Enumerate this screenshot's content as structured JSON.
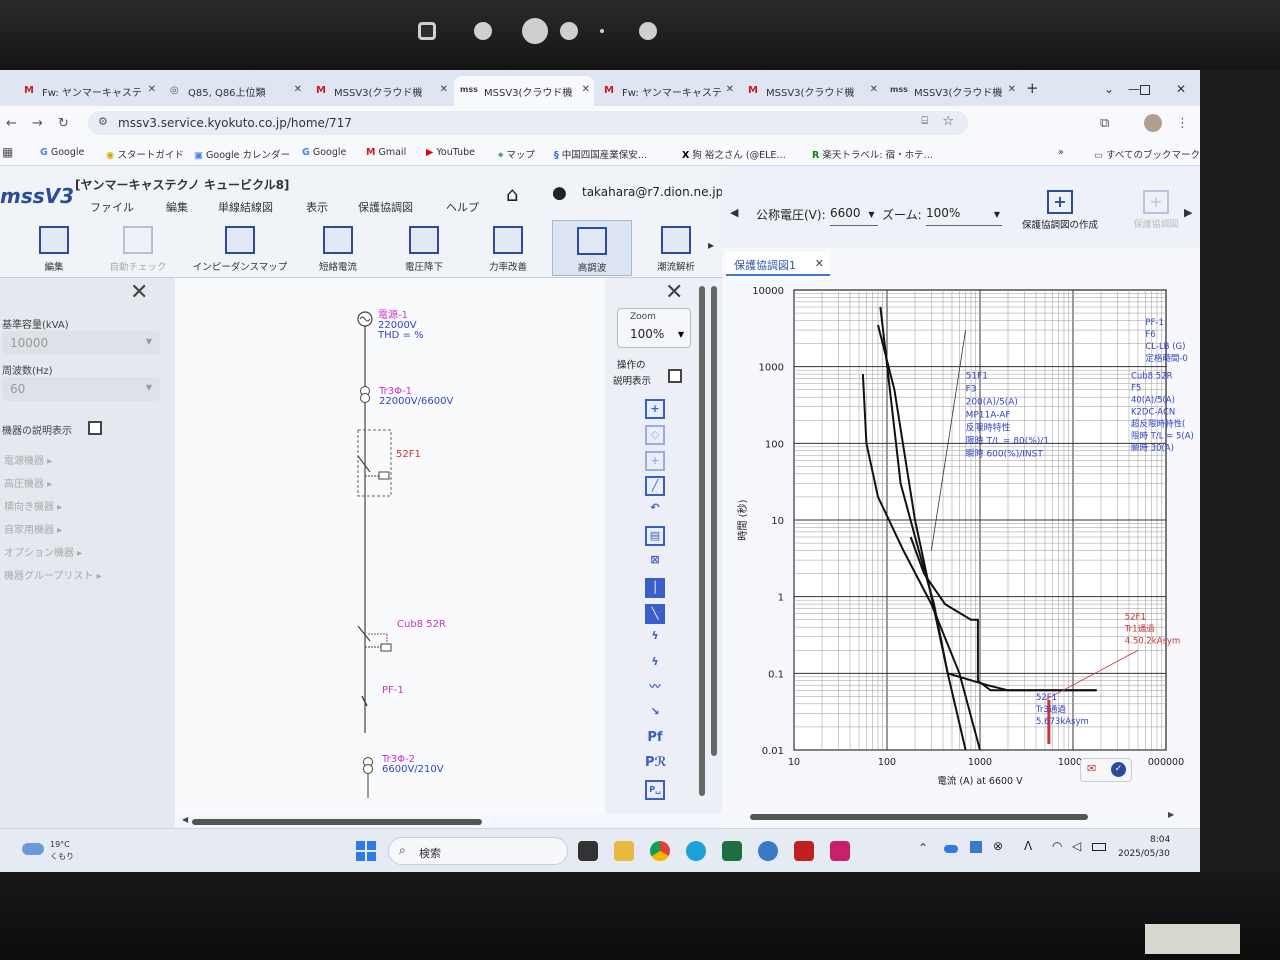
{
  "browser": {
    "tabs": [
      {
        "label": "Fw: ヤンマーキャステ",
        "fav": "M"
      },
      {
        "label": "Q85, Q86上位類",
        "fav": "◎"
      },
      {
        "label": "MSSV3(クラウド機",
        "fav": "M"
      },
      {
        "label": "MSSV3(クラウド機",
        "fav": "mss"
      },
      {
        "label": "Fw: ヤンマーキャステ",
        "fav": "M"
      },
      {
        "label": "MSSV3(クラウド機",
        "fav": "M"
      },
      {
        "label": "MSSV3(クラウド機",
        "fav": "mss"
      }
    ],
    "new_tab": "+",
    "url": "mssv3.service.kyokuto.co.jp/home/717",
    "bookmarks": [
      "Google",
      "スタートガイド",
      "Google カレンダー",
      "Google",
      "Gmail",
      "YouTube",
      "マップ",
      "中国四国産業保安…",
      "狗 裕之さん (@ELE…",
      "楽天トラベル: 宿・ホテ…",
      "すべてのブックマーク"
    ],
    "bookmarks_more": "»"
  },
  "app": {
    "logo": "mssV3",
    "project_title": "[ヤンマーキャステクノ キュービクル8]",
    "menus": [
      "ファイル",
      "編集",
      "単線結線図",
      "表示",
      "保護協調図",
      "ヘルプ"
    ],
    "user_email": "takahara@r7.dion.ne.jp",
    "ribbon": [
      {
        "label": "編集",
        "state": "normal"
      },
      {
        "label": "自動チェック",
        "state": "disabled"
      },
      {
        "label": "インピーダンスマップ",
        "state": "normal"
      },
      {
        "label": "短絡電流",
        "state": "normal"
      },
      {
        "label": "電圧降下",
        "state": "normal"
      },
      {
        "label": "力率改善",
        "state": "normal"
      },
      {
        "label": "高調波",
        "state": "active"
      },
      {
        "label": "潮流解析",
        "state": "normal"
      }
    ],
    "ribbon_more": "▸",
    "right_header": {
      "voltage_label": "公称電圧(V):",
      "voltage_value": "6600",
      "zoom_label": "ズーム:",
      "zoom_value": "100%",
      "create_label": "保護協調図の作成",
      "next_label": "保護協調図"
    }
  },
  "left_panel": {
    "base_capacity_label": "基準容量(kVA)",
    "base_capacity_value": "10000",
    "frequency_label": "周波数(Hz)",
    "frequency_value": "60",
    "device_desc_label": "機器の説明表示",
    "categories": [
      "電源機器",
      "高圧機器",
      "横向き機器",
      "自家用機器",
      "オプション機器",
      "機器グループリスト"
    ]
  },
  "diagram": {
    "source": {
      "name": "電源-1",
      "v": "22000V",
      "thd": "THD = %"
    },
    "tr1": {
      "name": "Tr3Φ-1",
      "v": "22000V/6600V"
    },
    "cb1": {
      "name": "52F1"
    },
    "cb2": {
      "name": "Cub8 52R"
    },
    "pf": {
      "name": "PF-1"
    },
    "tr2": {
      "name": "Tr3Φ-2",
      "v": "6600V/210V"
    }
  },
  "tool_panel": {
    "zoom_label": "Zoom",
    "zoom_value": "100%",
    "op_desc_label_1": "操作の",
    "op_desc_label_2": "説明表示",
    "pf_label": "Pf",
    "pr_label": "Pℛ"
  },
  "chart_tab": {
    "label": "保護協調図1"
  },
  "chart_data": {
    "type": "line",
    "x_scale": "log",
    "y_scale": "log",
    "xlim": [
      10,
      100000
    ],
    "ylim": [
      0.01,
      10000
    ],
    "x_ticks": [
      "10",
      "100",
      "1000",
      "10000",
      "000000"
    ],
    "y_ticks": [
      "10000",
      "1000",
      "100",
      "10",
      "1",
      "0.1",
      "0.01"
    ],
    "xlabel": "電流 (A) at 6600 V",
    "ylabel": "時間 (秒)",
    "grid": true,
    "series": [
      {
        "values": [
          {
            "x": 55,
            "y": 800
          },
          {
            "x": 60,
            "y": 100
          },
          {
            "x": 80,
            "y": 20
          },
          {
            "x": 150,
            "y": 4
          },
          {
            "x": 300,
            "y": 0.8
          },
          {
            "x": 600,
            "y": 0.1
          },
          {
            "x": 1000,
            "y": 0.01
          }
        ]
      },
      {
        "values": [
          {
            "x": 80,
            "y": 3500
          },
          {
            "x": 120,
            "y": 500
          },
          {
            "x": 200,
            "y": 10
          },
          {
            "x": 300,
            "y": 1
          },
          {
            "x": 450,
            "y": 0.1
          },
          {
            "x": 700,
            "y": 0.01
          }
        ]
      },
      {
        "values": [
          {
            "x": 85,
            "y": 6000
          },
          {
            "x": 140,
            "y": 30
          },
          {
            "x": 220,
            "y": 4
          },
          {
            "x": 320,
            "y": 0.8
          },
          {
            "x": 450,
            "y": 0.1
          },
          {
            "x": 1200,
            "y": 0.07
          },
          {
            "x": 2000,
            "y": 0.06
          },
          {
            "x": 18000,
            "y": 0.06
          }
        ]
      },
      {
        "values": [
          {
            "x": 180,
            "y": 6
          },
          {
            "x": 250,
            "y": 2
          },
          {
            "x": 420,
            "y": 0.8
          },
          {
            "x": 800,
            "y": 0.5
          },
          {
            "x": 950,
            "y": 0.5
          },
          {
            "x": 950,
            "y": 0.08
          },
          {
            "x": 1300,
            "y": 0.06
          },
          {
            "x": 18000,
            "y": 0.06
          }
        ]
      }
    ],
    "annotations": [
      {
        "lines": [
          "51F1",
          "F3",
          "200(A)/5(A)",
          "MP11A-AF",
          "反限時特性",
          "限時 T/L = 80(%)/1",
          "瞬時 600(%)/INST"
        ],
        "color": "#3344cc"
      },
      {
        "lines": [
          "PF-1",
          "F6",
          "CL-LB (G)",
          "定格時間-0"
        ],
        "color": "#3344cc"
      },
      {
        "lines": [
          "Cub8 52R",
          "F5",
          "40(A)/5(A)",
          "K2DC-ACN",
          "超反限時特性(",
          "限時 T/L = 5(A)",
          "瞬時 30(A)"
        ],
        "color": "#3344cc"
      },
      {
        "lines": [
          "52F1",
          "Tr1通過",
          "4.50.2kAsym"
        ],
        "color": "#cc3333"
      },
      {
        "lines": [
          "52F1",
          "Tr3通過",
          "5.673kAsym"
        ],
        "color": "#3344cc"
      }
    ]
  },
  "taskbar": {
    "weather_temp": "19°C",
    "weather_desc": "くもり",
    "search_label": "検索",
    "time": "8:04",
    "date": "2025/05/30"
  },
  "colors": {
    "accent": "#2a4c9a",
    "magenta": "#cc33cc",
    "blue_label": "#3344cc",
    "red_label": "#cc3333"
  }
}
